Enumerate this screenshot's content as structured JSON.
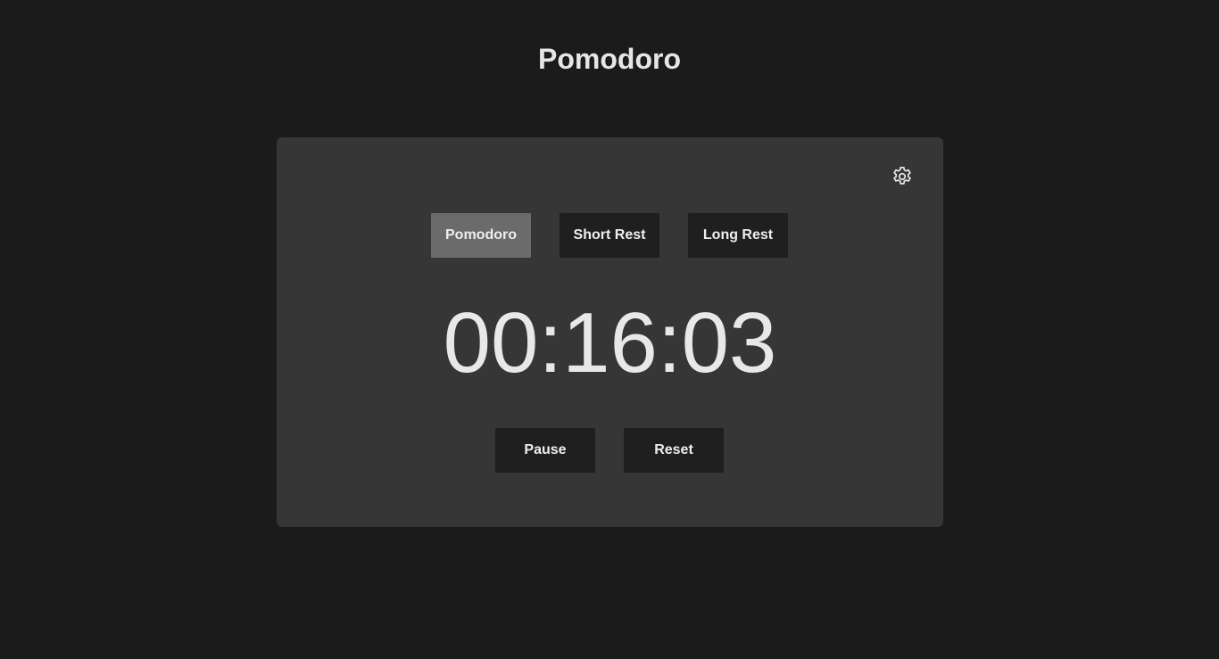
{
  "page": {
    "title": "Pomodoro"
  },
  "card": {
    "settings_icon": "gear-icon",
    "tabs": [
      {
        "label": "Pomodoro",
        "active": true
      },
      {
        "label": "Short Rest",
        "active": false
      },
      {
        "label": "Long Rest",
        "active": false
      }
    ],
    "timer": "00:16:03",
    "controls": {
      "pause_label": "Pause",
      "reset_label": "Reset"
    }
  },
  "colors": {
    "background": "#1b1b1b",
    "card": "#363636",
    "button": "#1f1f1f",
    "button_active": "#6b6b6b",
    "text": "#e6e6e6"
  }
}
